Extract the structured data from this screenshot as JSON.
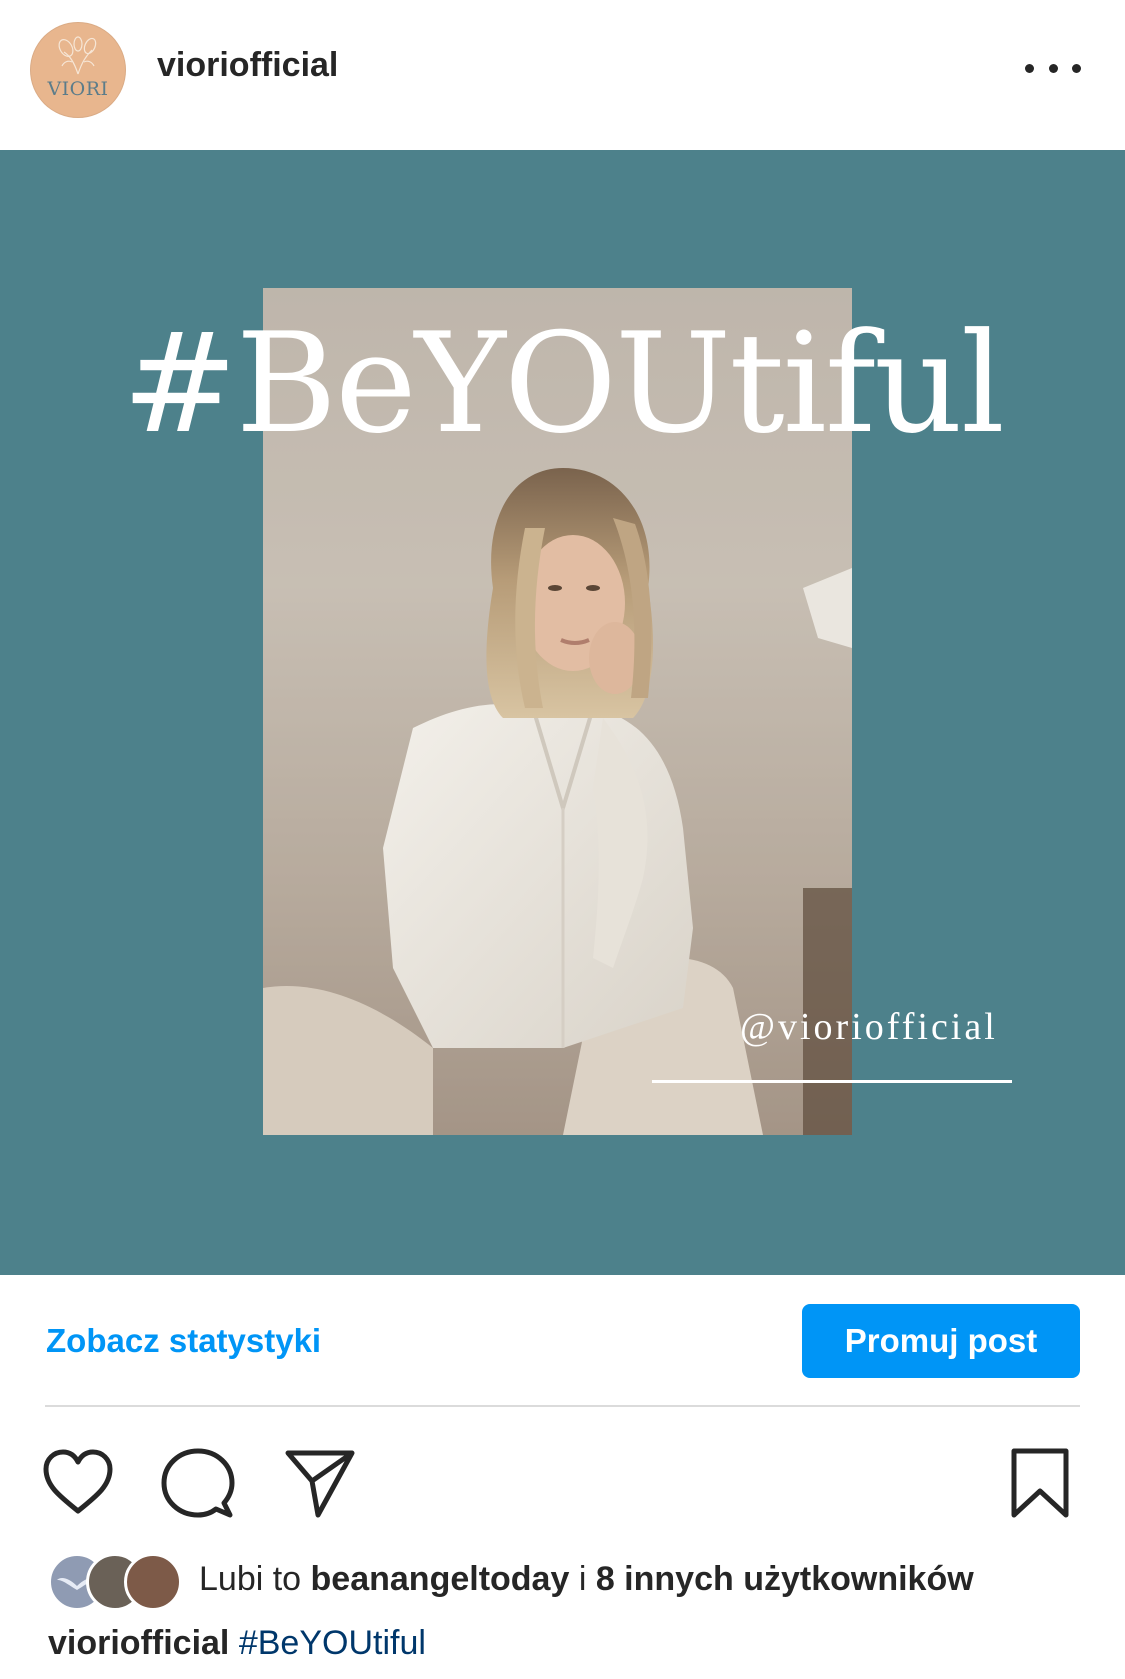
{
  "header": {
    "avatar_text": "VIORI",
    "username": "vioriofficial",
    "more_icon": "more-horizontal-icon"
  },
  "post": {
    "background_color": "#4d818b",
    "overlay_title": "#BeYOUtiful",
    "overlay_handle": "@vioriofficial"
  },
  "insights": {
    "stats_link": "Zobacz statystyki",
    "promote_button": "Promuj post",
    "accent_color": "#0095f6"
  },
  "actions": {
    "like_icon": "heart-icon",
    "comment_icon": "comment-icon",
    "share_icon": "send-icon",
    "save_icon": "bookmark-icon"
  },
  "likes": {
    "prefix": "Lubi to ",
    "first_user": "beanangeltoday",
    "joiner": " i ",
    "others": "8 innych użytkowników"
  },
  "caption": {
    "username": "vioriofficial",
    "text": "#BeYOUtiful"
  }
}
